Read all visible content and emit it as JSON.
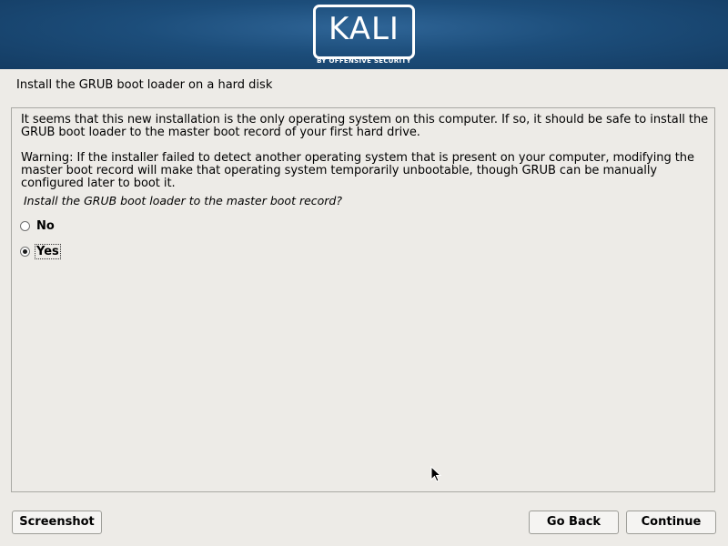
{
  "banner": {
    "logo_text": "KALI",
    "logo_subtitle": "BY OFFENSIVE SECURITY"
  },
  "page": {
    "title": "Install the GRUB boot loader on a hard disk"
  },
  "content": {
    "paragraph1": "It seems that this new installation is the only operating system on this computer. If so, it should be safe to install the GRUB boot loader to the master boot record of your first hard drive.",
    "paragraph2": "Warning: If the installer failed to detect another operating system that is present on your computer, modifying the master boot record will make that operating system temporarily unbootable, though GRUB can be manually configured later to boot it.",
    "question": "Install the GRUB boot loader to the master boot record?",
    "options": [
      {
        "label": "No",
        "selected": false
      },
      {
        "label": "Yes",
        "selected": true
      }
    ]
  },
  "buttons": {
    "screenshot": "Screenshot",
    "go_back": "Go Back",
    "continue": "Continue"
  },
  "icons": {
    "cursor": "mouse-pointer-icon"
  },
  "colors": {
    "banner": "#1c4d7a",
    "background": "#edebe7"
  }
}
